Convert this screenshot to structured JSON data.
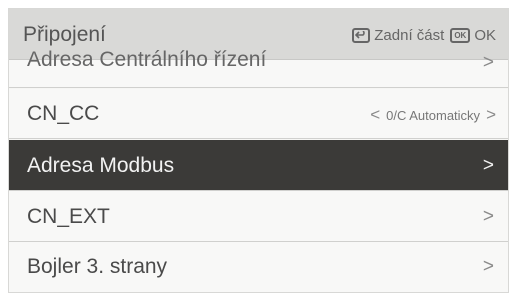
{
  "header": {
    "title": "Připojení",
    "back_label": "Zadní část",
    "ok_icon_text": "OK",
    "ok_label": "OK"
  },
  "rows": [
    {
      "label": "Adresa Centrálního řízení",
      "chevron": ">"
    },
    {
      "label": "CN_CC",
      "value": "0/C Automaticky",
      "left_chevron": "<",
      "chevron": ">"
    },
    {
      "label": "Adresa Modbus",
      "chevron": ">",
      "selected": true
    },
    {
      "label": "CN_EXT",
      "chevron": ">"
    },
    {
      "label": "Bojler 3. strany",
      "chevron": ">"
    }
  ],
  "colors": {
    "header_bg": "#d9d9d7",
    "selected_row_bg": "#3b3a38",
    "row_bg": "#f8f8f7"
  }
}
